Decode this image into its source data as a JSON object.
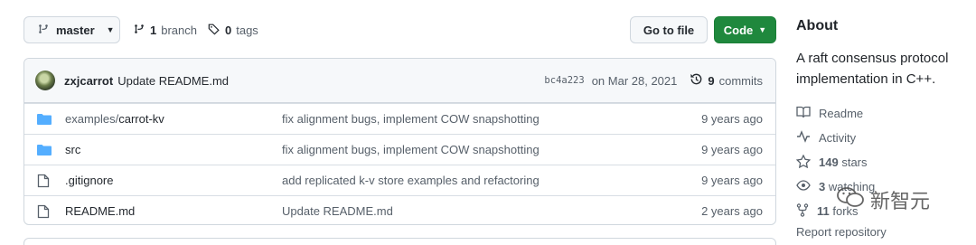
{
  "toolbar": {
    "branch": "master",
    "branches_count": "1",
    "branches_label": "branch",
    "tags_count": "0",
    "tags_label": "tags",
    "goto_label": "Go to file",
    "code_label": "Code"
  },
  "commit": {
    "author": "zxjcarrot",
    "message": "Update README.md",
    "hash": "bc4a223",
    "date": "on Mar 28, 2021",
    "commits_count": "9",
    "commits_label": "commits"
  },
  "files": [
    {
      "type": "folder",
      "prefix": "examples/",
      "name": "carrot-kv",
      "commit": "fix alignment bugs, implement COW snapshotting",
      "age": "9 years ago"
    },
    {
      "type": "folder",
      "prefix": "",
      "name": "src",
      "commit": "fix alignment bugs, implement COW snapshotting",
      "age": "9 years ago"
    },
    {
      "type": "file",
      "prefix": "",
      "name": ".gitignore",
      "commit": "add replicated k-v store examples and refactoring",
      "age": "9 years ago"
    },
    {
      "type": "file",
      "prefix": "",
      "name": "README.md",
      "commit": "Update README.md",
      "age": "2 years ago"
    }
  ],
  "about": {
    "title": "About",
    "description": "A raft consensus protocol implementation in C++.",
    "readme": "Readme",
    "activity": "Activity",
    "stars_count": "149",
    "stars_label": "stars",
    "watching_count": "3",
    "watching_label": "watching",
    "forks_count": "11",
    "forks_label": "forks",
    "report": "Report repository"
  },
  "watermark": "新智元",
  "colors": {
    "accent": "#1f883d",
    "folder": "#54aeff",
    "muted": "#57606a"
  }
}
